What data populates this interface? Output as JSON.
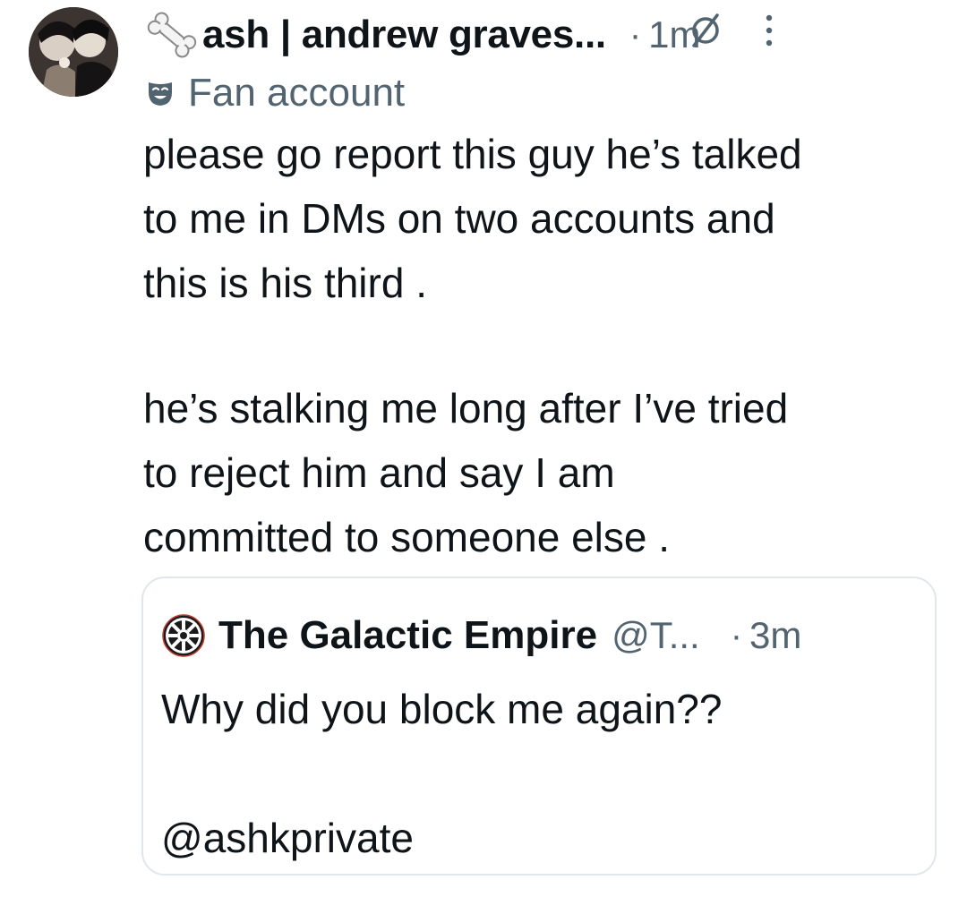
{
  "post": {
    "avatar_icon": "user-avatar",
    "author_icon": "bone-icon",
    "display_name": "ash | andrew graves...",
    "separator": "·",
    "time": "1m",
    "status_icon": "no-entry-icon",
    "more_icon": "more-vertical-icon",
    "account_label_icon": "theater-mask-icon",
    "account_label": "Fan account",
    "text_lines": [
      "please go report this guy he’s talked",
      "to me in DMs on two accounts and",
      "this is his third ."
    ],
    "text_lines_2": [
      "he’s stalking me long after I’ve tried",
      "to reject him and say I am",
      "committed to someone else ."
    ]
  },
  "quote": {
    "avatar_icon": "galactic-empire-icon",
    "display_name": "The Galactic Empire",
    "handle": "@T...",
    "separator": "·",
    "time": "3m",
    "text_line_1": "Why did you block me again??",
    "text_line_2": "@ashkprivate"
  },
  "colors": {
    "text_primary": "#0f1419",
    "text_secondary": "#536471",
    "card_border": "#e1e6ea"
  }
}
